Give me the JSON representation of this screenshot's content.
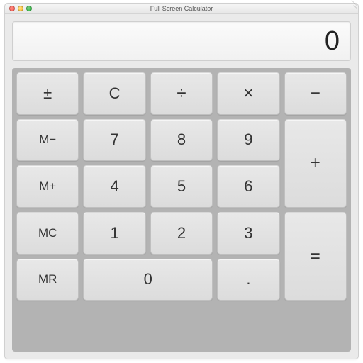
{
  "window": {
    "title": "Full Screen Calculator"
  },
  "display": {
    "value": "0"
  },
  "keys": {
    "plus_minus": "±",
    "clear": "C",
    "divide": "÷",
    "multiply": "×",
    "minus": "−",
    "m_minus": "M−",
    "m_plus": "M+",
    "mc": "MC",
    "mr": "MR",
    "seven": "7",
    "eight": "8",
    "nine": "9",
    "four": "4",
    "five": "5",
    "six": "6",
    "one": "1",
    "two": "2",
    "three": "3",
    "zero": "0",
    "plus": "+",
    "equals": "=",
    "decimal": "."
  }
}
